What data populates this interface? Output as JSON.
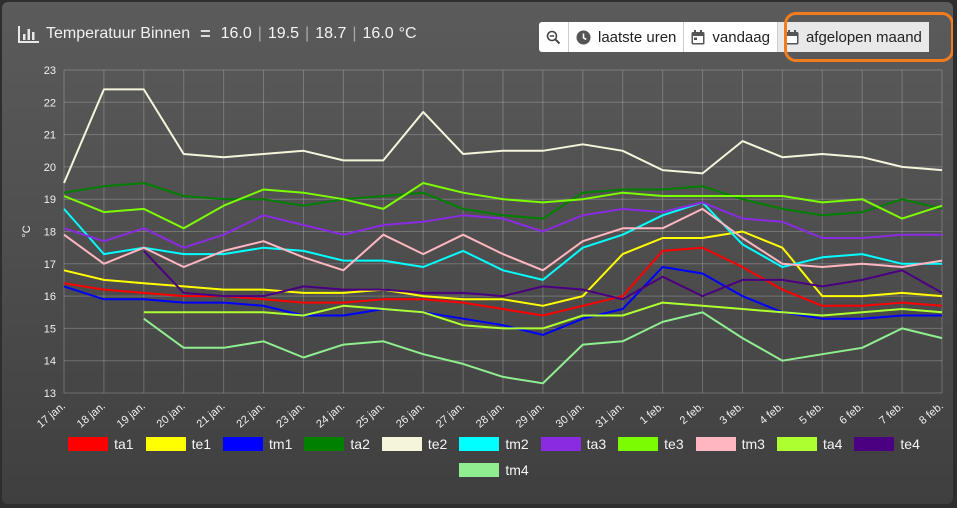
{
  "header": {
    "title": "Temperatuur Binnen",
    "values": [
      "16.0",
      "19.5",
      "18.7",
      "16.0"
    ],
    "unit": "°C"
  },
  "toolbar": {
    "last_hours": "laatste uren",
    "today": "vandaag",
    "last_month": "afgelopen maand",
    "highlight_color": "#f07c1e"
  },
  "chart_data": {
    "type": "line",
    "ylabel": "°C",
    "ylim": [
      13,
      23
    ],
    "yticks": [
      13,
      14,
      15,
      16,
      17,
      18,
      19,
      20,
      21,
      22,
      23
    ],
    "grid": true,
    "legend_position": "bottom",
    "categories": [
      "17 jan.",
      "18 jan.",
      "19 jan.",
      "20 jan.",
      "21 jan.",
      "22 jan.",
      "23 jan.",
      "24 jan.",
      "25 jan.",
      "26 jan.",
      "27 jan.",
      "28 jan.",
      "29 jan.",
      "30 jan.",
      "31 jan.",
      "1 feb.",
      "2 feb.",
      "3 feb.",
      "4 feb.",
      "5 feb.",
      "6 feb.",
      "7 feb.",
      "8 feb."
    ],
    "series": [
      {
        "name": "ta1",
        "color": "#ff0000",
        "values": [
          16.4,
          16.2,
          16.1,
          16.0,
          16.0,
          15.9,
          15.8,
          15.8,
          15.9,
          15.9,
          15.8,
          15.6,
          15.4,
          15.7,
          16.0,
          17.4,
          17.5,
          16.9,
          16.2,
          15.7,
          15.7,
          15.8,
          15.7
        ]
      },
      {
        "name": "te1",
        "color": "#ffff00",
        "values": [
          16.8,
          16.5,
          16.4,
          16.3,
          16.2,
          16.2,
          16.1,
          16.1,
          16.2,
          16.0,
          15.9,
          15.9,
          15.7,
          16.0,
          17.3,
          17.8,
          17.8,
          18.0,
          17.5,
          16.0,
          16.0,
          16.1,
          16.0
        ]
      },
      {
        "name": "tm1",
        "color": "#0000ff",
        "values": [
          16.3,
          15.9,
          15.9,
          15.8,
          15.8,
          15.7,
          15.4,
          15.4,
          15.6,
          15.5,
          15.3,
          15.1,
          14.8,
          15.3,
          15.6,
          16.9,
          16.7,
          16.0,
          15.5,
          15.3,
          15.3,
          15.4,
          15.4
        ]
      },
      {
        "name": "ta2",
        "color": "#008000",
        "values": [
          19.2,
          19.4,
          19.5,
          19.1,
          19.0,
          19.0,
          18.8,
          19.0,
          19.1,
          19.2,
          18.7,
          18.5,
          18.4,
          19.2,
          19.3,
          19.3,
          19.4,
          19.0,
          18.7,
          18.5,
          18.6,
          19.0,
          18.7
        ]
      },
      {
        "name": "te2",
        "color": "#f5f5dc",
        "values": [
          19.5,
          22.4,
          22.4,
          20.4,
          20.3,
          20.4,
          20.5,
          20.2,
          20.2,
          21.7,
          20.4,
          20.5,
          20.5,
          20.7,
          20.5,
          19.9,
          19.8,
          20.8,
          20.3,
          20.4,
          20.3,
          20.0,
          19.9
        ]
      },
      {
        "name": "tm2",
        "color": "#00ffff",
        "values": [
          18.7,
          17.3,
          17.5,
          17.3,
          17.3,
          17.5,
          17.4,
          17.1,
          17.1,
          16.9,
          17.4,
          16.8,
          16.5,
          17.5,
          17.9,
          18.5,
          18.9,
          17.6,
          16.9,
          17.2,
          17.3,
          17.0,
          17.0
        ]
      },
      {
        "name": "ta3",
        "color": "#8a2be2",
        "values": [
          18.1,
          17.7,
          18.1,
          17.5,
          17.9,
          18.5,
          18.2,
          17.9,
          18.2,
          18.3,
          18.5,
          18.4,
          18.0,
          18.5,
          18.7,
          18.6,
          18.9,
          18.4,
          18.3,
          17.8,
          17.8,
          17.9,
          17.9
        ]
      },
      {
        "name": "te3",
        "color": "#7cfc00",
        "values": [
          19.1,
          18.6,
          18.7,
          18.1,
          18.8,
          19.3,
          19.2,
          19.0,
          18.7,
          19.5,
          19.2,
          19.0,
          18.9,
          19.0,
          19.2,
          19.1,
          19.1,
          19.1,
          19.1,
          18.9,
          19.0,
          18.4,
          18.8
        ]
      },
      {
        "name": "tm3",
        "color": "#ffb6c1",
        "values": [
          17.9,
          17.0,
          17.5,
          16.9,
          17.4,
          17.7,
          17.2,
          16.8,
          17.9,
          17.3,
          17.9,
          17.3,
          16.8,
          17.7,
          18.1,
          18.1,
          18.7,
          17.8,
          17.0,
          16.9,
          17.0,
          16.9,
          17.1
        ]
      },
      {
        "name": "ta4",
        "color": "#adff2f",
        "values": [
          null,
          null,
          15.5,
          15.5,
          15.5,
          15.5,
          15.4,
          15.7,
          15.6,
          15.5,
          15.1,
          15.0,
          15.0,
          15.4,
          15.4,
          15.8,
          15.7,
          15.6,
          15.5,
          15.4,
          15.5,
          15.6,
          15.5
        ]
      },
      {
        "name": "te4",
        "color": "#4b0082",
        "values": [
          null,
          null,
          17.4,
          16.1,
          16.0,
          16.0,
          16.3,
          16.2,
          16.2,
          16.1,
          16.1,
          16.0,
          16.3,
          16.2,
          15.9,
          16.6,
          16.0,
          16.5,
          16.5,
          16.3,
          16.5,
          16.8,
          16.1
        ]
      },
      {
        "name": "tm4",
        "color": "#90ee90",
        "values": [
          null,
          null,
          15.3,
          14.4,
          14.4,
          14.6,
          14.1,
          14.5,
          14.6,
          14.2,
          13.9,
          13.5,
          13.3,
          14.5,
          14.6,
          15.2,
          15.5,
          14.7,
          14.0,
          14.2,
          14.4,
          15.0,
          14.7
        ]
      }
    ]
  }
}
